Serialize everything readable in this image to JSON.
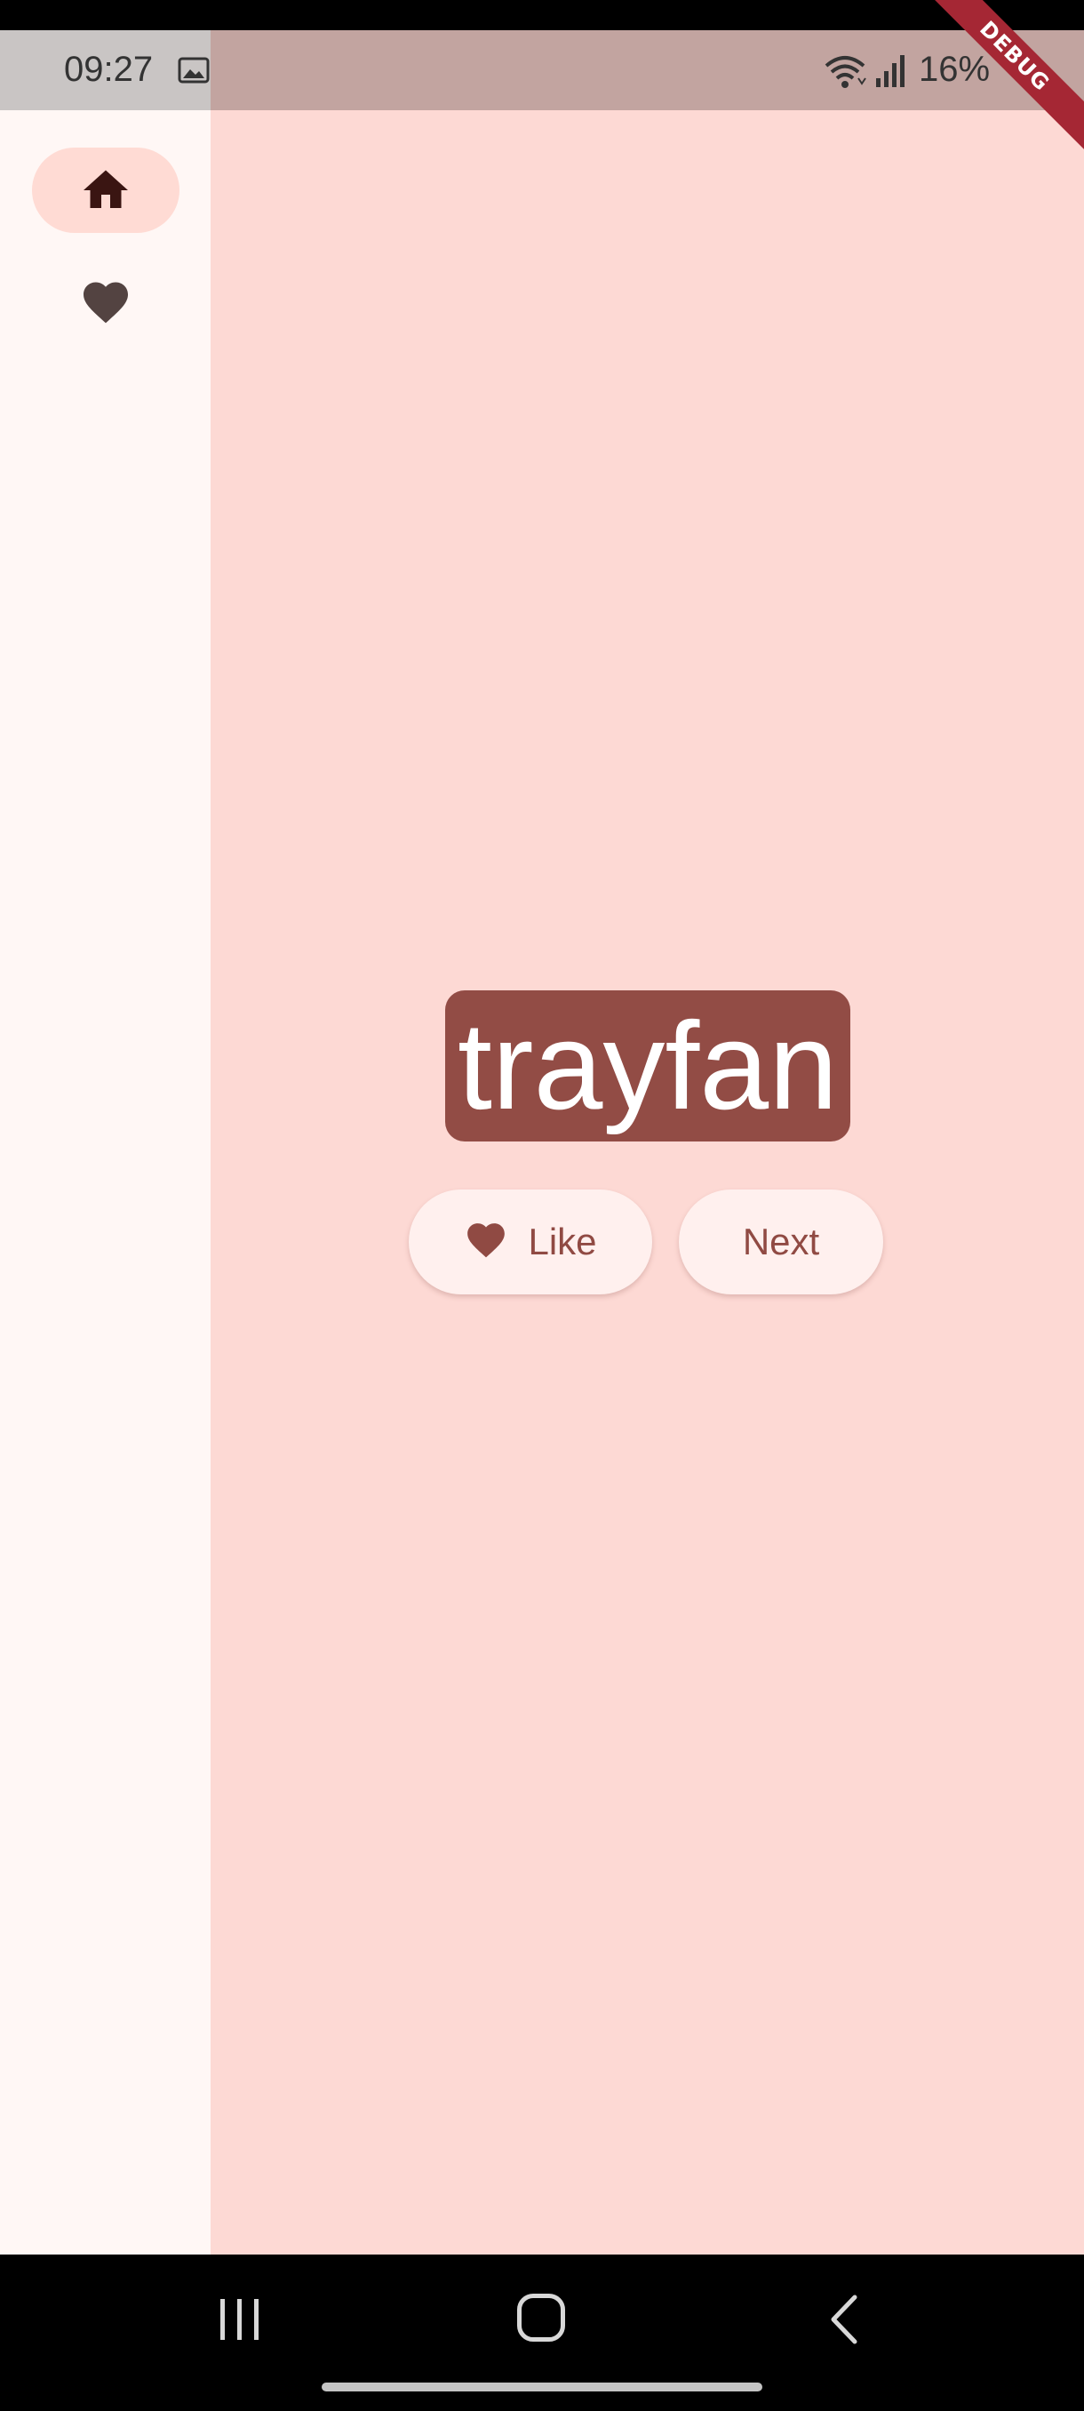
{
  "status_bar": {
    "time": "09:27",
    "battery": "16%",
    "icons": [
      "gallery-icon",
      "wifi-icon",
      "signal-icon"
    ]
  },
  "debug_banner": "DEBUG",
  "nav_rail": {
    "items": [
      {
        "icon": "home-icon",
        "selected": true
      },
      {
        "icon": "heart-icon",
        "selected": false
      }
    ]
  },
  "main": {
    "word": "trayfan",
    "like_label": "Like",
    "next_label": "Next"
  },
  "colors": {
    "background": "#fdd9d4",
    "rail": "#fff7f5",
    "rail_indicator": "#ffdbd4",
    "card": "#924c45",
    "button_bg": "#fff0ee",
    "button_text": "#904a43"
  },
  "system_nav": {
    "buttons": [
      "recents-icon",
      "home-circle-icon",
      "back-icon"
    ]
  }
}
